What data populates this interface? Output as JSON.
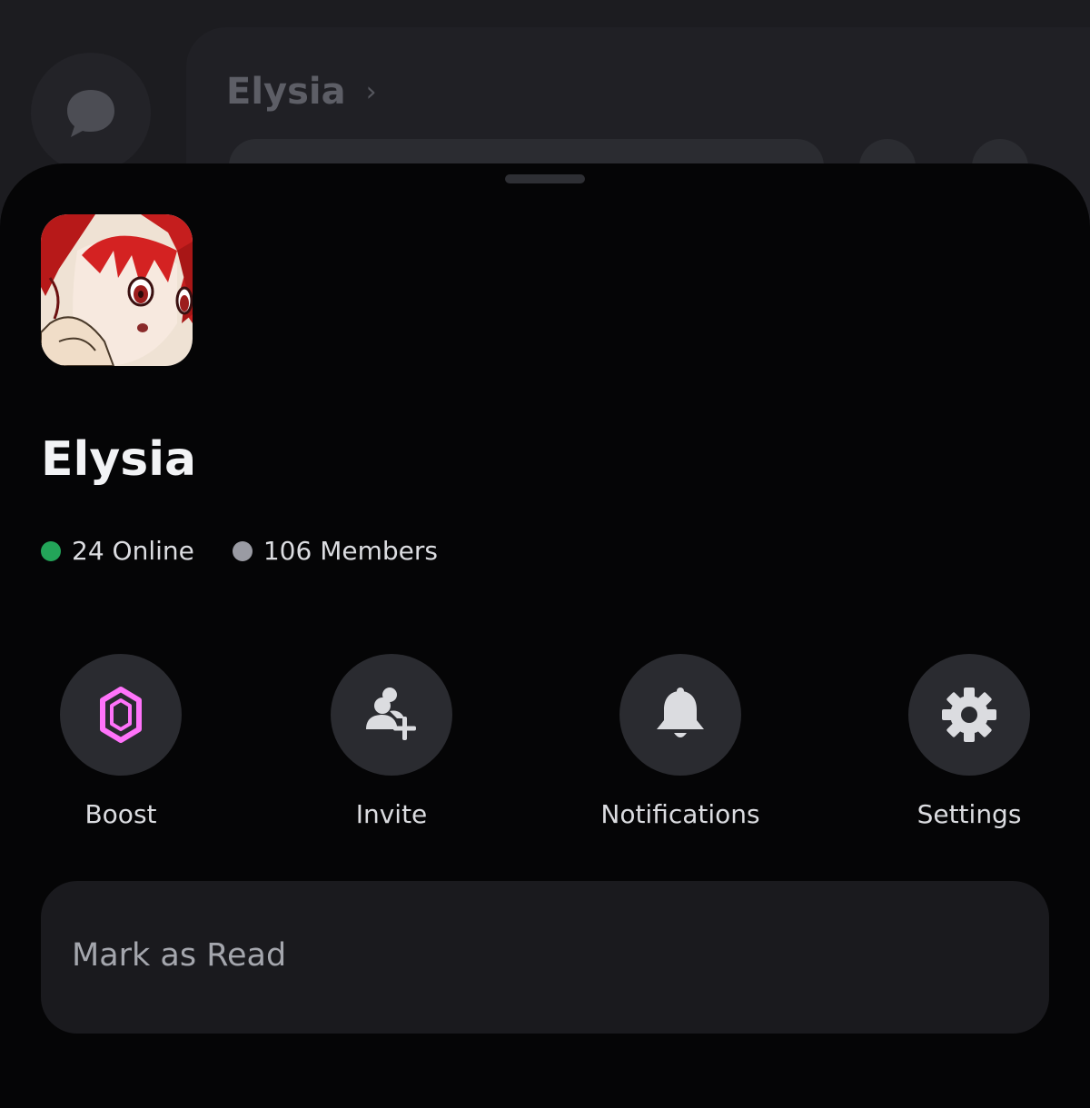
{
  "background": {
    "channel_title": "Elysia",
    "chevron": "›",
    "dm_icon": "chat-bubble-icon"
  },
  "server": {
    "name": "Elysia",
    "icon": "server-avatar-anime-girl",
    "online_label": "24 Online",
    "members_label": "106 Members",
    "online_color": "#23a559",
    "members_color": "#9a9ba3"
  },
  "actions": [
    {
      "label": "Boost",
      "icon": "boost-gem-icon",
      "icon_color": "#ff73fa"
    },
    {
      "label": "Invite",
      "icon": "invite-user-plus-icon",
      "icon_color": "#dbdce0"
    },
    {
      "label": "Notifications",
      "icon": "bell-icon",
      "icon_color": "#dbdce0"
    },
    {
      "label": "Settings",
      "icon": "gear-icon",
      "icon_color": "#dbdce0"
    }
  ],
  "menu": {
    "mark_as_read": "Mark as Read"
  }
}
